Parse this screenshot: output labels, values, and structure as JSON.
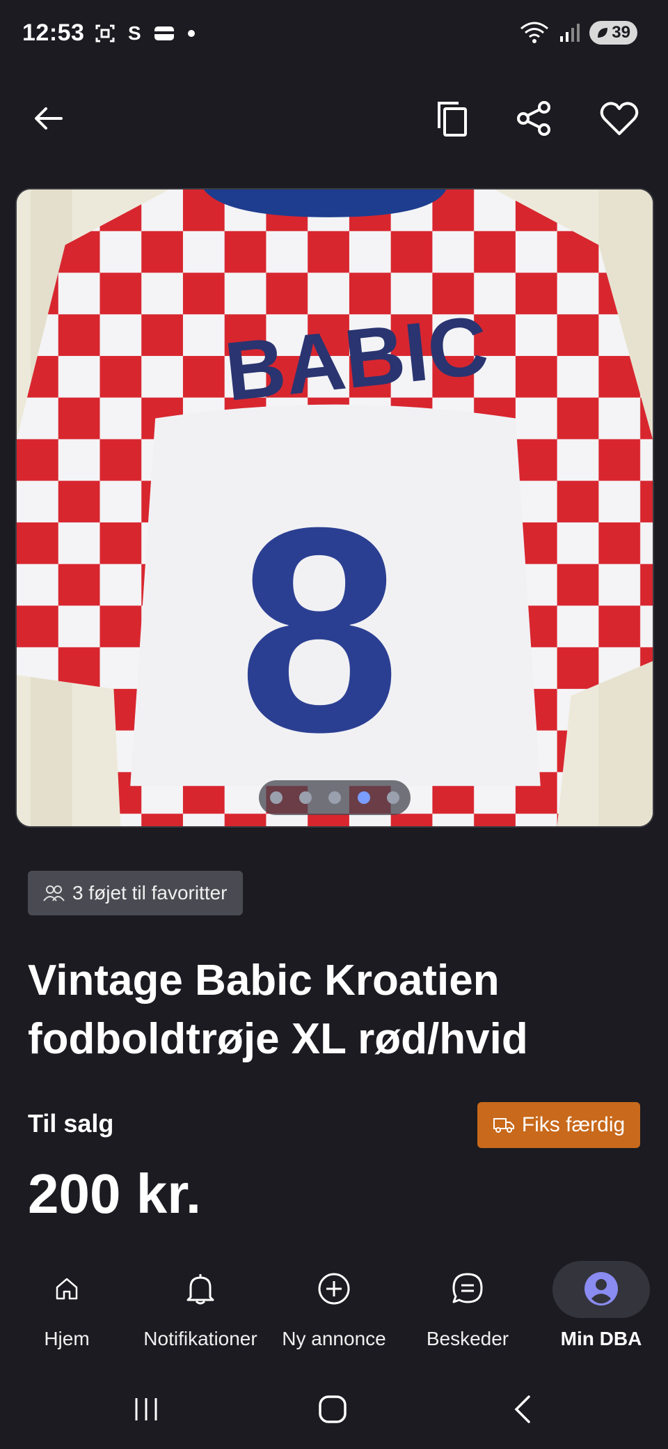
{
  "status": {
    "time": "12:53",
    "left_icons": [
      "screenshot-icon",
      "s-icon",
      "wallet-icon",
      "dot-icon"
    ],
    "battery": "39"
  },
  "top_bar": {
    "icons": [
      "back-arrow-icon",
      "copy-icon",
      "share-icon",
      "heart-icon"
    ]
  },
  "carousel": {
    "image_description": "",
    "total_images": 5,
    "active_index": 3
  },
  "listing": {
    "favorites_text": "3 føjet til favoritter",
    "title": "Vintage Babic Kroatien fodboldtrøje XL rød/hvid",
    "status": "Til salg",
    "fiks_label": "Fiks færdig",
    "price": "200 kr."
  },
  "bottom_nav": {
    "items": [
      {
        "label": "Hjem",
        "icon": "home-icon"
      },
      {
        "label": "Notifikationer",
        "icon": "bell-icon"
      },
      {
        "label": "Ny annonce",
        "icon": "plus-circle-icon"
      },
      {
        "label": "Beskeder",
        "icon": "chat-icon"
      },
      {
        "label": "Min DBA",
        "icon": "avatar-icon"
      }
    ],
    "active": "Min DBA"
  },
  "colors": {
    "background": "#1b1b21",
    "accent_orange": "#c8691b",
    "active_dot": "#7a9dff",
    "jersey_red": "#d8262f",
    "jersey_blue": "#1e3d8f"
  }
}
